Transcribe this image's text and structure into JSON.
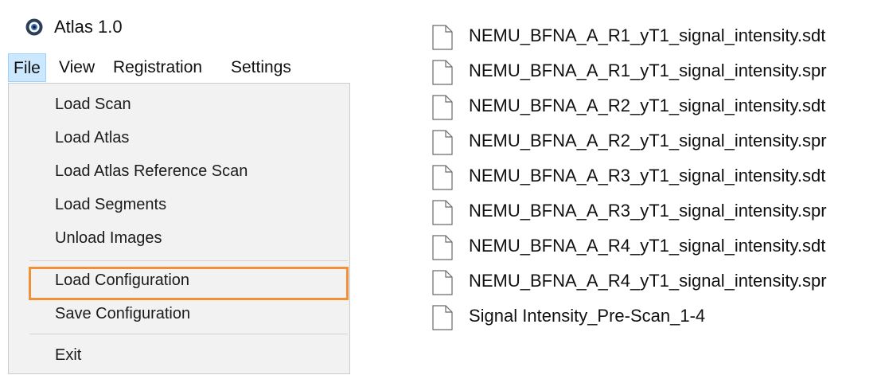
{
  "app": {
    "title": "Atlas 1.0",
    "icon": "eye-icon"
  },
  "menubar": {
    "items": [
      {
        "label": "File",
        "active": true
      },
      {
        "label": "View"
      },
      {
        "label": "Registration"
      },
      {
        "label": "Settings"
      }
    ]
  },
  "file_menu": {
    "items": [
      {
        "label": "Load Scan"
      },
      {
        "label": "Load Atlas"
      },
      {
        "label": "Load Atlas Reference Scan"
      },
      {
        "label": "Load Segments"
      },
      {
        "label": "Unload Images"
      },
      {
        "label": "Load Configuration",
        "highlighted": true
      },
      {
        "label": "Save Configuration"
      },
      {
        "label": "Exit"
      }
    ],
    "highlight_color": "#f0913a"
  },
  "files": [
    {
      "name": "NEMU_BFNA_A_R1_yT1_signal_intensity.sdt"
    },
    {
      "name": "NEMU_BFNA_A_R1_yT1_signal_intensity.spr"
    },
    {
      "name": "NEMU_BFNA_A_R2_yT1_signal_intensity.sdt"
    },
    {
      "name": "NEMU_BFNA_A_R2_yT1_signal_intensity.spr"
    },
    {
      "name": "NEMU_BFNA_A_R3_yT1_signal_intensity.sdt"
    },
    {
      "name": "NEMU_BFNA_A_R3_yT1_signal_intensity.spr"
    },
    {
      "name": "NEMU_BFNA_A_R4_yT1_signal_intensity.sdt"
    },
    {
      "name": "NEMU_BFNA_A_R4_yT1_signal_intensity.spr"
    },
    {
      "name": "Signal Intensity_Pre-Scan_1-4"
    }
  ],
  "colors": {
    "menu_active_bg": "#cce8ff",
    "dropdown_bg": "#f2f2f2"
  }
}
